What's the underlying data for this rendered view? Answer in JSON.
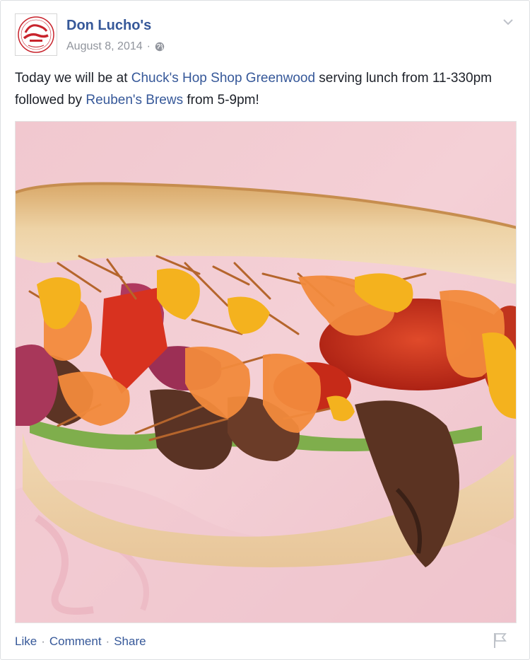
{
  "post": {
    "author": "Don Lucho's",
    "date": "August 8, 2014",
    "date_separator": "·",
    "privacy_icon": "globe-icon",
    "text_parts": {
      "t1": "Today we will be at ",
      "link1": "Chuck's Hop Shop Greenwood",
      "t2": " serving lunch from 11-330pm followed by ",
      "link2": "Reuben's Brews",
      "t3": " from 5-9pm!"
    },
    "avatar_logo_text": "don lucho's"
  },
  "actions": {
    "like": "Like",
    "comment": "Comment",
    "share": "Share",
    "separator": "·"
  },
  "colors": {
    "link": "#365899",
    "meta": "#90949c",
    "text": "#1d2129",
    "logo_red": "#c8232c"
  }
}
